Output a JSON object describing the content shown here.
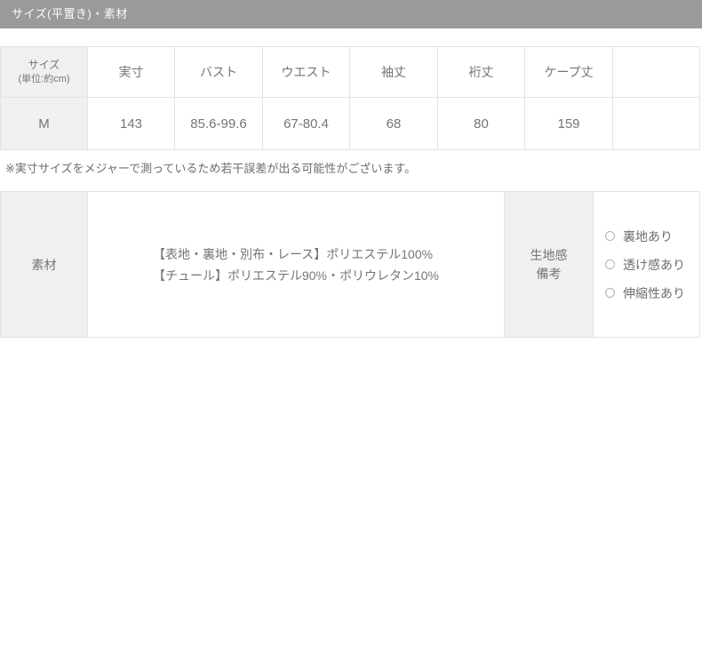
{
  "section_header": {
    "title": "サイズ(平置き)・素材"
  },
  "size_table": {
    "size_col": {
      "label": "サイズ",
      "unit": "(単位:約cm)"
    },
    "columns": [
      "実寸",
      "バスト",
      "ウエスト",
      "袖丈",
      "裄丈",
      "ケープ丈"
    ],
    "row": {
      "size": "M",
      "values": [
        "143",
        "85.6-99.6",
        "67-80.4",
        "68",
        "80",
        "159"
      ]
    }
  },
  "note": "※実寸サイズをメジャーで測っているため若干誤差が出る可能性がございます。",
  "material_table": {
    "label": "素材",
    "composition_lines": [
      "【表地・裏地・別布・レース】ポリエステル100%",
      "【チュール】ポリエステル90%・ポリウレタン10%"
    ],
    "fabric_label_lines": [
      "生地感",
      "備考"
    ],
    "options": [
      "裏地あり",
      "透け感あり",
      "伸縮性あり"
    ]
  },
  "colors": {
    "header_bg": "#9a9a9a",
    "cell_gray_bg": "#f0f0ef",
    "border": "#e2e2e1",
    "text": "#757575"
  }
}
